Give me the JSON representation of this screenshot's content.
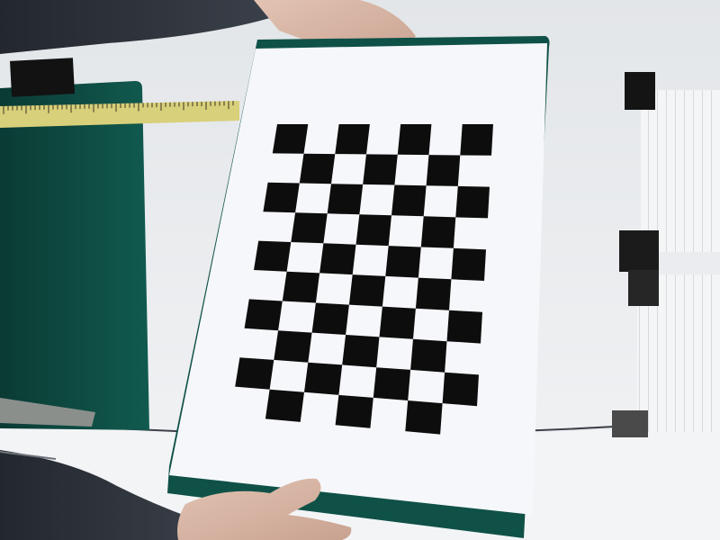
{
  "scene": {
    "subject": "",
    "checkerboard": {
      "rows": 10,
      "cols": 7
    },
    "colors": {
      "clipboard_green": "#0f4f45",
      "paper_white": "#f6f7fb",
      "checker_black": "#0d0d0d",
      "tape_black": "#1c1c1c",
      "measuring_tape_yellow": "#d8d07a",
      "table_white": "#eceff1",
      "sleeve_dark": "#2a2f36",
      "skin": "#d8b8a8"
    }
  }
}
